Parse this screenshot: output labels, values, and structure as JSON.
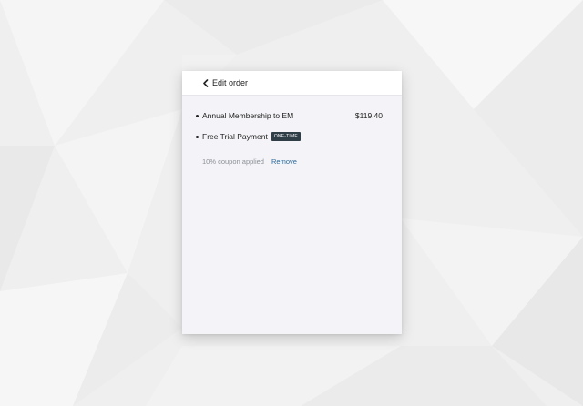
{
  "header": {
    "back_label": "Edit order"
  },
  "order": {
    "items": [
      {
        "name": "Annual Membership to EM",
        "price": "$119.40"
      },
      {
        "name": "Free Trial Payment",
        "badge": "ONE-TIME"
      }
    ],
    "coupon_text": "10% coupon applied",
    "remove_label": "Remove"
  },
  "colors": {
    "badge_bg": "#2f3d47",
    "link": "#2d6a9a",
    "card_bg": "#f4f4f8"
  }
}
